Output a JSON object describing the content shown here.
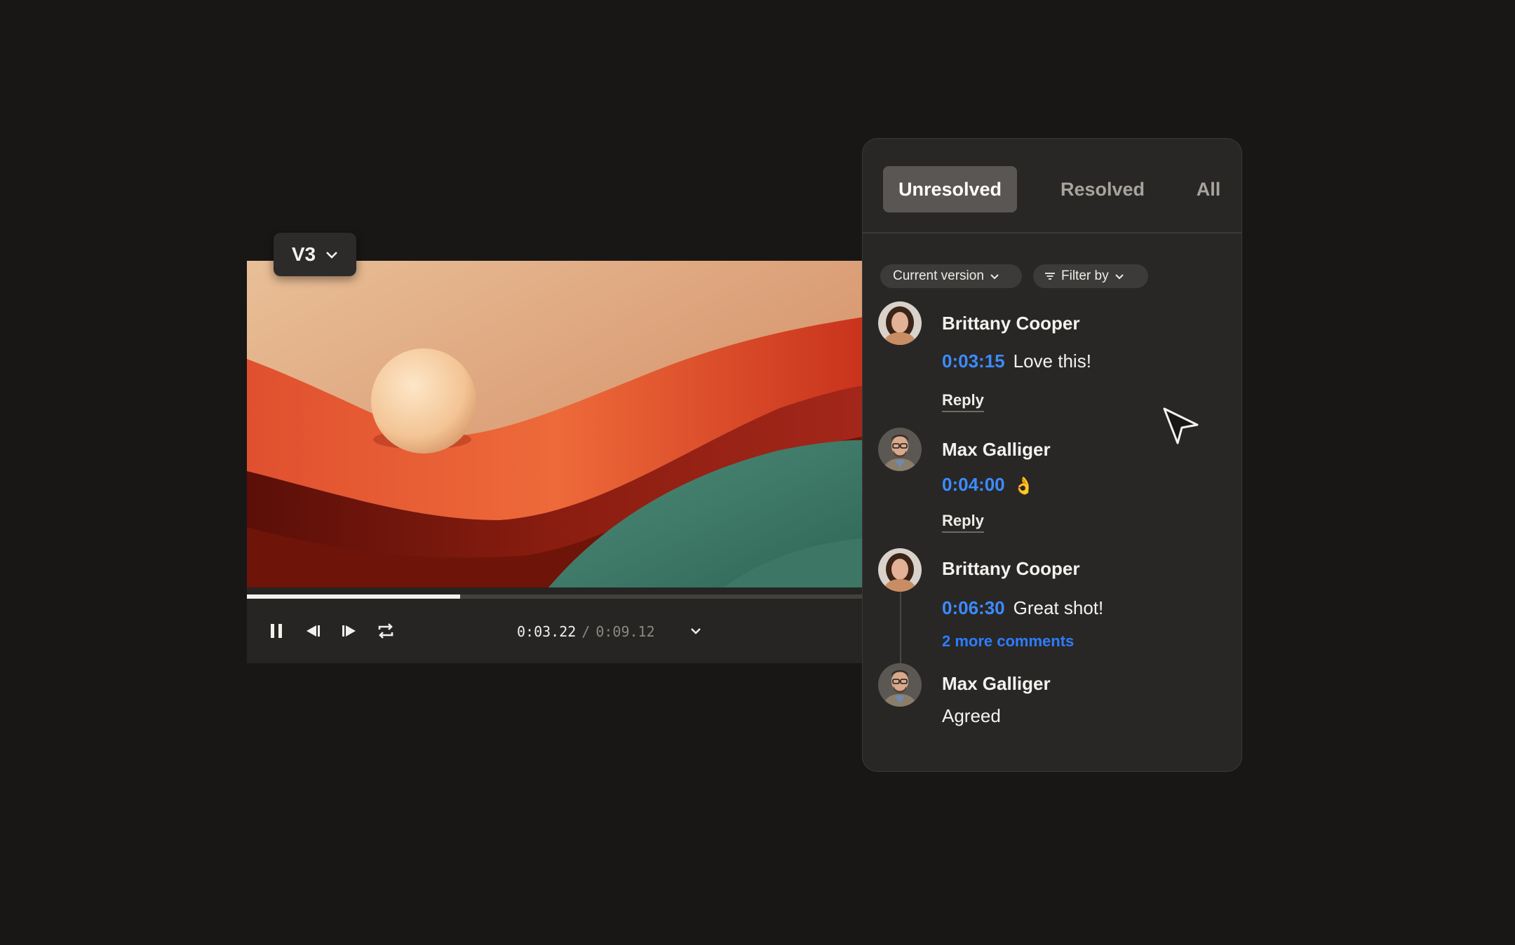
{
  "player": {
    "version_label": "V3",
    "current_time": "0:03.22",
    "separator": "/",
    "duration": "0:09.12",
    "progress_fraction": 0.345
  },
  "comments_panel": {
    "tabs": [
      {
        "label": "Unresolved",
        "active": true
      },
      {
        "label": "Resolved",
        "active": false
      },
      {
        "label": "All",
        "active": false
      }
    ],
    "filters": {
      "version_label": "Current version",
      "filter_label": "Filter by"
    },
    "comments": [
      {
        "author": "Brittany Cooper",
        "timestamp": "0:03:15",
        "text": "Love this!",
        "reply_label": "Reply"
      },
      {
        "author": "Max Galliger",
        "timestamp": "0:04:00",
        "text": "👌",
        "reply_label": "Reply"
      },
      {
        "author": "Brittany Cooper",
        "timestamp": "0:06:30",
        "text": "Great shot!",
        "more_label": "2 more comments"
      },
      {
        "author": "Max Galliger",
        "text": "Agreed"
      }
    ]
  },
  "colors": {
    "background": "#181716",
    "panel": "#282726",
    "accent_blue": "#3d8bff",
    "active_tab": "#5a5653"
  }
}
